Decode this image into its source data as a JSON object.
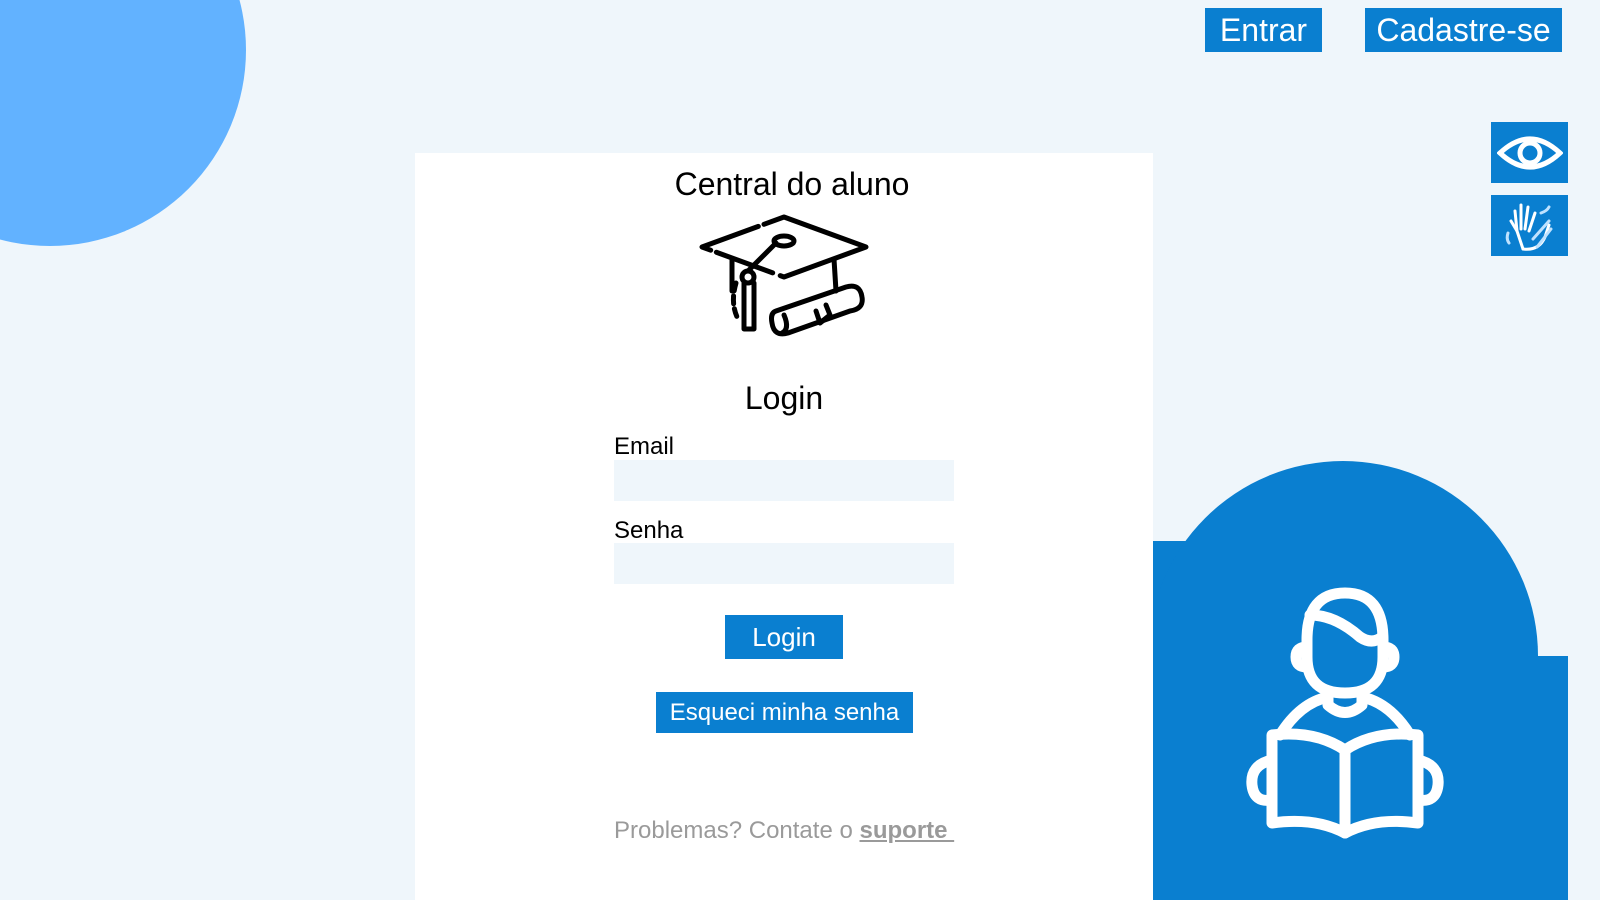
{
  "header": {
    "login_label": "Entrar",
    "signup_label": "Cadastre-se"
  },
  "accessibility": {
    "visibility_icon": "eye-icon",
    "sign_language_icon": "sign-language-hand-icon"
  },
  "card": {
    "title": "Central do aluno",
    "title_icon": "graduation-cap-icon",
    "heading": "Login",
    "fields": {
      "email_label": "Email",
      "email_value": "",
      "password_label": "Senha",
      "password_value": ""
    },
    "login_button": "Login",
    "forgot_button": "Esqueci minha senha",
    "help_text": "Problemas? Contate o ",
    "help_link": "suporte "
  },
  "decor": {
    "illustration_icon": "student-reading-book-icon"
  },
  "colors": {
    "primary": "#0a7fd0",
    "light_blob": "#62b2ff",
    "background": "#eff6fb"
  }
}
